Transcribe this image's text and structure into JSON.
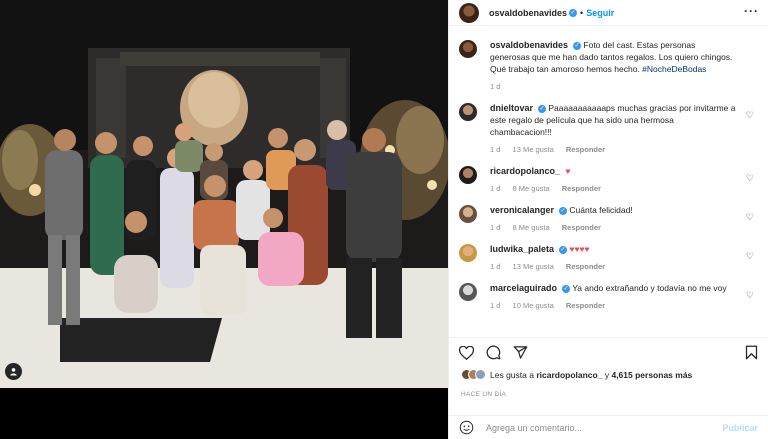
{
  "post": {
    "username": "osvaldobenavides",
    "follow_label": "Seguir",
    "separator": "•"
  },
  "caption": {
    "username": "osvaldobenavides",
    "text": "Foto del cast. Estas personas generosas que me han dado tantos regalos. Los quiero chingos. Qué trabajo tan amoroso hemos hecho.",
    "hashtag": "#NocheDeBodas",
    "time": "1 d"
  },
  "comments": [
    {
      "username": "dnieltovar",
      "verified": true,
      "text": "Paaaaaaaaaaaps muchas gracias por invitarme a este regalo de película que ha sido una hermosa chambacacion!!!",
      "time": "1 d",
      "likes": "13 Me gusta",
      "reply": "Responder"
    },
    {
      "username": "ricardopolanco_",
      "verified": false,
      "text": "♥",
      "time": "1 d",
      "likes": "8 Me gusta",
      "reply": "Responder"
    },
    {
      "username": "veronicalanger",
      "verified": true,
      "text": "Cuánta felicidad!",
      "time": "1 d",
      "likes": "8 Me gusta",
      "reply": "Responder"
    },
    {
      "username": "ludwika_paleta",
      "verified": true,
      "text": "♥♥♥♥",
      "time": "1 d",
      "likes": "13 Me gusta",
      "reply": "Responder"
    },
    {
      "username": "marcelaguirado",
      "verified": true,
      "text": "Ya ando extrañando y todavía no me voy",
      "time": "1 d",
      "likes": "10 Me gusta",
      "reply": "Responder"
    }
  ],
  "likes": {
    "prefix": "Les gusta a",
    "user": "ricardopolanco_",
    "mid": "y",
    "count": "4,615 personas más"
  },
  "timestamp": "HACE UN DÍA",
  "composer": {
    "placeholder": "Agrega un comentario...",
    "publish_label": "Publicar"
  },
  "icons": {
    "more": "more-options-icon",
    "like": "heart-icon",
    "comment": "comment-icon",
    "share": "share-icon",
    "save": "bookmark-icon",
    "emoji": "emoji-icon",
    "tag": "user-tag-icon"
  },
  "colors": {
    "accent": "#0095f6",
    "verified": "#3897f0",
    "heart": "#ed4956"
  }
}
